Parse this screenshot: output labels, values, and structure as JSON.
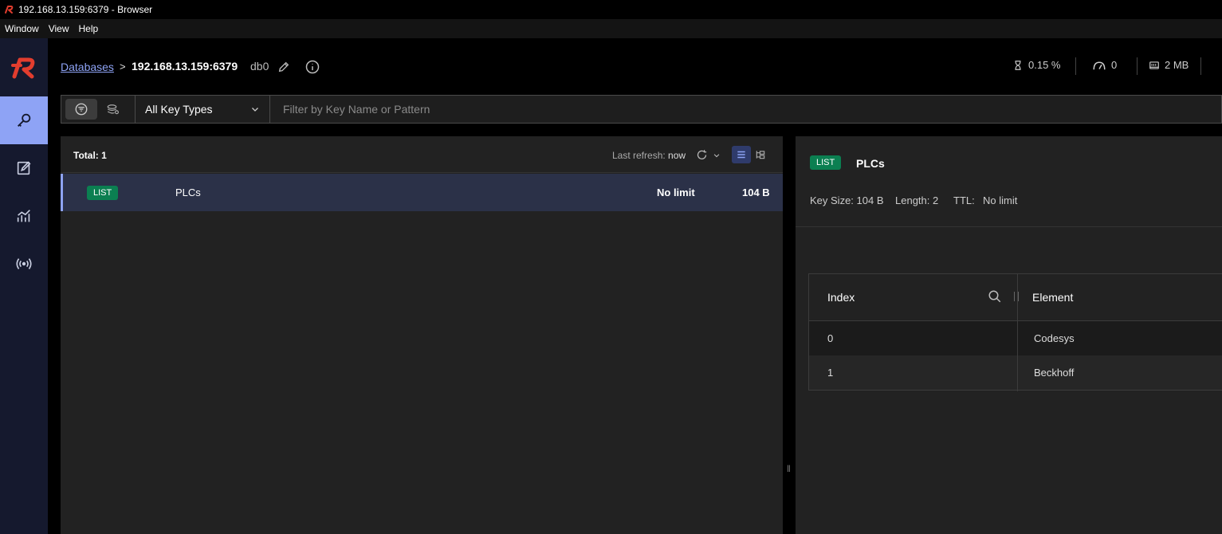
{
  "window": {
    "title": "192.168.13.159:6379 - Browser"
  },
  "menu": [
    "Window",
    "View",
    "Help"
  ],
  "header": {
    "breadcrumb_link": "Databases",
    "breadcrumb_sep": ">",
    "host": "192.168.13.159:6379",
    "db": "db0",
    "stats": {
      "cpu": "0.15 %",
      "ops": "0",
      "memory": "2 MB"
    }
  },
  "filter": {
    "key_type": "All Key Types",
    "placeholder": "Filter by Key Name or Pattern"
  },
  "key_list": {
    "total": "Total: 1",
    "refresh_prefix": "Last refresh:",
    "refresh_value": "now",
    "rows": [
      {
        "type": "LIST",
        "name": "PLCs",
        "ttl": "No limit",
        "size": "104 B"
      }
    ]
  },
  "detail": {
    "type": "LIST",
    "name": "PLCs",
    "key_size": "Key Size: 104 B",
    "length": "Length: 2",
    "ttl_label": "TTL:",
    "ttl_value": "No limit",
    "columns": [
      "Index",
      "Element"
    ],
    "rows": [
      {
        "index": "0",
        "element": "Codesys"
      },
      {
        "index": "1",
        "element": "Beckhoff"
      }
    ]
  },
  "colors": {
    "accent": "#8ea3f5",
    "list_badge": "#0b7f51",
    "brand": "#e23d2e",
    "sidebar": "#15192e"
  }
}
